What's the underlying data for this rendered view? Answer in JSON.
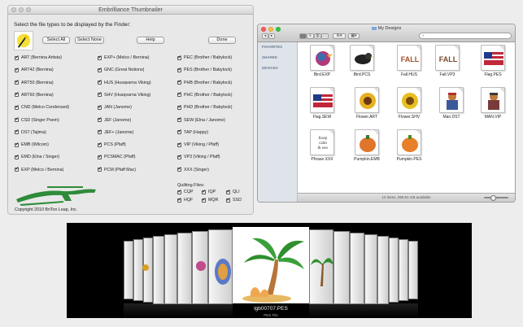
{
  "left_window": {
    "title": "Embrilliance Thumbnailer",
    "instruction": "Select the file types to be displayed by the Finder:",
    "buttons": {
      "select_all": "Select All",
      "select_none": "Select None",
      "help": "Help",
      "done": "Done"
    },
    "col1": [
      "ART (Bernina Artista)",
      "ART42 (Bernina)",
      "ART50 (Bernina)",
      "ART60 (Bernina)",
      "CND (Melco Condensed)",
      "CSD (Singer Poem)",
      "DST (Tajima)",
      "EMB (Wilcom)",
      "EMD (Elna / Singer)",
      "EXP (Melco / Bernina)"
    ],
    "col2": [
      "EXP+ (Melco / Bernina)",
      "GNC (Great Notions)",
      "HUS (Husqvarna Viking)",
      "SHV (Husqvarna Viking)",
      "JAN (Janome)",
      "JEF (Janome)",
      "JEF+ (Janome)",
      "PCS (Pfaff)",
      "PCSMAC (Pfaff)",
      "PCM (Pfaff Mac)"
    ],
    "col3": [
      "PEC (Brother / Babylock)",
      "PES (Brother / Babylock)",
      "PHB (Brother / Babylock)",
      "PHC (Brother / Babylock)",
      "PHD (Brother / Babylock)",
      "SEW (Elna / Janome)",
      "TAP (Happy)",
      "VIP (Viking / Pfaff)",
      "VP3 (Viking / Pfaff)",
      "XXX (Singer)"
    ],
    "quilting_title": "Quilting Files:",
    "quilting": [
      "CQP",
      "IQP",
      "QLI",
      "HQF",
      "MQR",
      "SSD"
    ],
    "copyright": "Copyright 2010 BriTon Leap, Inc."
  },
  "finder": {
    "title": "My Designs",
    "sidebar": [
      "FAVORITES",
      "SHARED",
      "DEVICES"
    ],
    "files": [
      {
        "name": "Bird.EXP",
        "badge": "EXP"
      },
      {
        "name": "Bird.PCS",
        "badge": ""
      },
      {
        "name": "Fall.HUS",
        "badge": "FALL"
      },
      {
        "name": "Fall.VP3",
        "badge": "FALL"
      },
      {
        "name": "Flag.PES",
        "badge": ""
      },
      {
        "name": "Flag.SEW",
        "badge": ""
      },
      {
        "name": "Flower.ART",
        "badge": ""
      },
      {
        "name": "Flower.SHV",
        "badge": ""
      },
      {
        "name": "Man.DST",
        "badge": ""
      },
      {
        "name": "MAN.VIP",
        "badge": ""
      },
      {
        "name": "Phrase.XXX",
        "badge": ""
      },
      {
        "name": "Pumpkin.EMB",
        "badge": ""
      },
      {
        "name": "Pumpkin.PES",
        "badge": ""
      }
    ],
    "status": "13 items, 859.51 GB available"
  },
  "coverflow": {
    "filename": "lgb00707.PES",
    "kind": "PES File"
  },
  "colors": {
    "finder_sidebar": "#dfe4ea",
    "coverflow_bg": "#000000",
    "accent_green": "#2e8b3a"
  }
}
